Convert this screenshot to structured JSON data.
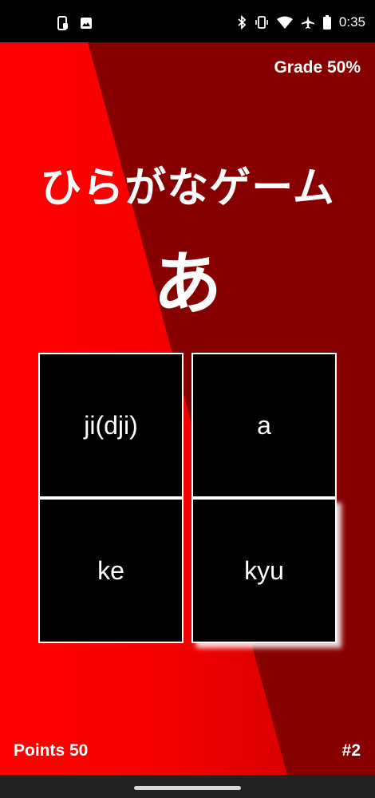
{
  "status_bar": {
    "time": "0:35",
    "left_icons": [
      "phone-screen-icon",
      "image-icon"
    ],
    "right_icons": [
      "bluetooth-icon",
      "vibrate-icon",
      "wifi-icon",
      "airplane-icon",
      "battery-icon"
    ]
  },
  "game": {
    "grade_label": "Grade 50%",
    "title": "ひらがなゲーム",
    "kana": "あ",
    "choices": [
      "ji(dji)",
      "a",
      "ke",
      "kyu"
    ],
    "points_label": "Points 50",
    "question_number": "#2"
  },
  "colors": {
    "background_bright": "#ff0000",
    "background_dark": "#7a0000",
    "tile": "#000000",
    "text": "#ffffff"
  }
}
